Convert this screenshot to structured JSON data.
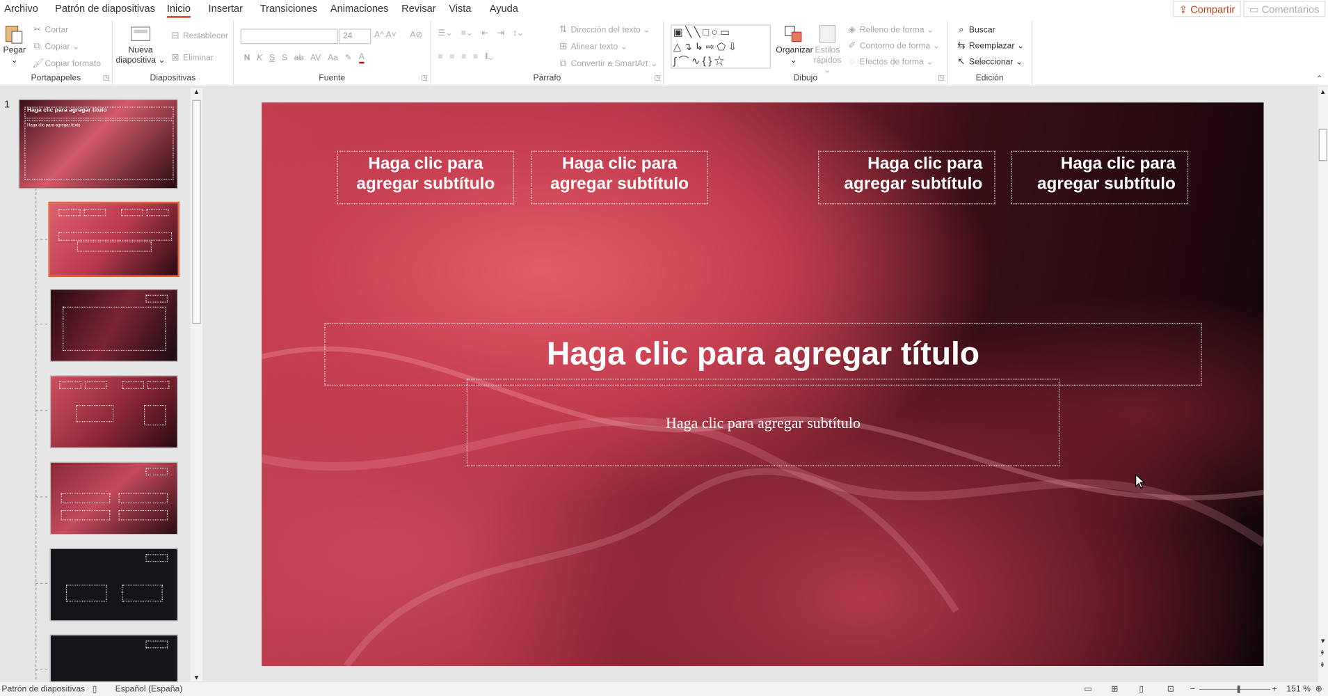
{
  "tabs": [
    "Archivo",
    "Patrón de diapositivas",
    "Inicio",
    "Insertar",
    "Transiciones",
    "Animaciones",
    "Revisar",
    "Vista",
    "Ayuda"
  ],
  "share_label": "Compartir",
  "comments_label": "Comentarios",
  "groups": {
    "clipboard": "Portapapeles",
    "slides": "Diapositivas",
    "font": "Fuente",
    "paragraph": "Párrafo",
    "drawing": "Dibujo",
    "editing": "Edición"
  },
  "clipboard": {
    "paste": "Pegar",
    "cut": "Cortar",
    "copy": "Copiar",
    "format_painter": "Copiar formato"
  },
  "slides": {
    "new_slide": "Nueva diapositiva",
    "reset": "Restablecer",
    "delete": "Eliminar"
  },
  "font": {
    "size": "24",
    "bold": "N",
    "italic": "K",
    "underline": "S",
    "shadow": "S",
    "strike": "ab",
    "spacing": "AV",
    "case": "Aa"
  },
  "paragraph": {
    "direction": "Dirección del texto",
    "align": "Alinear texto",
    "smartart": "Convertir a SmartArt"
  },
  "drawing": {
    "arrange": "Organizar",
    "quick_styles": "Estilos rápidos",
    "fill": "Relleno de forma",
    "outline": "Contorno de forma",
    "effects": "Efectos de forma"
  },
  "editing": {
    "find": "Buscar",
    "replace": "Reemplazar",
    "select": "Seleccionar"
  },
  "thumb_number": "1",
  "thumb1_title": "Haga clic para agregar título",
  "thumb1_text": "Haga clic para agregar texto",
  "slide": {
    "subtitle": "Haga clic para agregar subtítulo",
    "title": "Haga clic para agregar título",
    "main_subtitle": "Haga clic para agregar subtítulo"
  },
  "status": {
    "mode": "Patrón de diapositivas",
    "language": "Español (España)",
    "zoom": "151 %"
  },
  "colors": {
    "accent": "#c43e1c",
    "selection": "#e2663b"
  },
  "icons": [
    "paste-icon",
    "cut-icon",
    "copy-icon",
    "format-painter-icon",
    "new-slide-icon",
    "shapes-icon",
    "arrange-icon",
    "search-icon",
    "replace-icon",
    "select-icon"
  ]
}
